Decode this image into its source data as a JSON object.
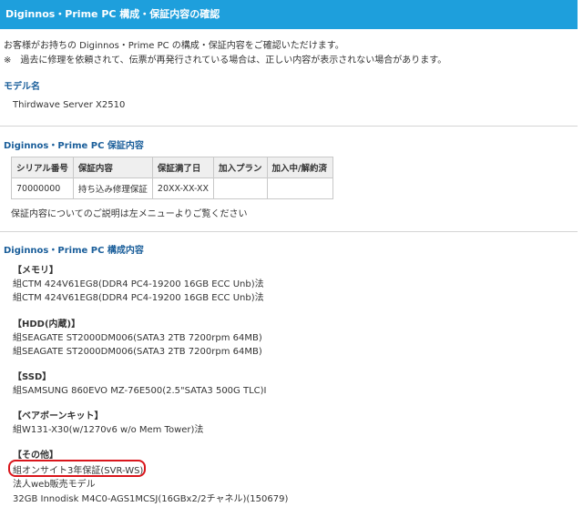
{
  "header": {
    "title": "Diginnos・Prime PC 構成・保証内容の確認"
  },
  "intro": {
    "line1": "お客様がお持ちの Diginnos・Prime PC の構成・保証内容をご確認いただけます。",
    "line2": "※　過去に修理を依頼されて、伝票が再発行されている場合は、正しい内容が表示されない場合があります。"
  },
  "model": {
    "heading": "モデル名",
    "value": "Thirdwave Server X2510"
  },
  "warranty": {
    "heading": "Diginnos・Prime PC 保証内容",
    "columns": [
      "シリアル番号",
      "保証内容",
      "保証満了日",
      "加入プラン",
      "加入中/解約済"
    ],
    "rows": [
      [
        "70000000",
        "持ち込み修理保証",
        "20XX-XX-XX",
        "",
        ""
      ]
    ],
    "note": "保証内容についてのご説明は左メニューよりご覧ください"
  },
  "config": {
    "heading": "Diginnos・Prime PC 構成内容",
    "sections": [
      {
        "title": "【メモリ】",
        "items": [
          "組CTM 424V61EG8(DDR4 PC4-19200 16GB ECC Unb)法",
          "組CTM 424V61EG8(DDR4 PC4-19200 16GB ECC Unb)法"
        ]
      },
      {
        "title": "【HDD(内蔵)】",
        "items": [
          "組SEAGATE ST2000DM006(SATA3 2TB 7200rpm 64MB)",
          "組SEAGATE ST2000DM006(SATA3 2TB 7200rpm 64MB)"
        ]
      },
      {
        "title": "【SSD】",
        "items": [
          "組SAMSUNG 860EVO MZ-76E500(2.5\"SATA3 500G TLC)I"
        ]
      },
      {
        "title": "【ベアボーンキット】",
        "items": [
          "組W131-X30(w/1270v6 w/o Mem Tower)法"
        ]
      },
      {
        "title": "【その他】",
        "items": [
          "組オンサイト3年保証(SVR-WS)",
          "法人web販売モデル",
          "32GB Innodisk M4C0-AGS1MCSJ(16GBx2/2チャネル)(150679)"
        ]
      }
    ]
  },
  "highlight": {
    "color": "#d9161c"
  }
}
